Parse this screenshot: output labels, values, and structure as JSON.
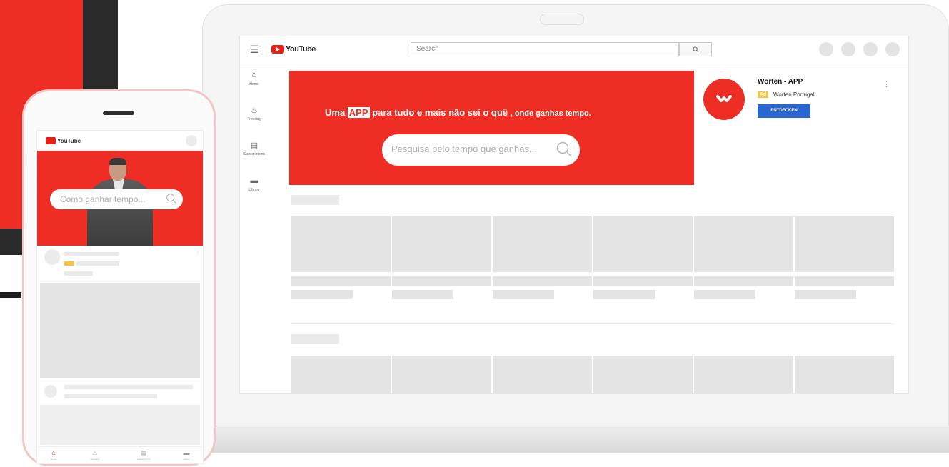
{
  "desktop": {
    "header": {
      "menu_icon": "hamburger-icon",
      "logo_text": "YouTube",
      "search_placeholder": "Search",
      "search_icon": "search-icon"
    },
    "sidebar": {
      "items": [
        {
          "label": "Home",
          "icon": "home-icon"
        },
        {
          "label": "Trending",
          "icon": "flame-icon"
        },
        {
          "label": "Subscriptions",
          "icon": "subscriptions-icon"
        },
        {
          "label": "Library",
          "icon": "folder-icon"
        }
      ]
    },
    "banner": {
      "text_before": "Uma ",
      "badge": "APP",
      "text_main": " para tudo e mais não sei o quê ",
      "text_end": ", onde ganhas tempo.",
      "search_placeholder": "Pesquisa pelo tempo que ganhas...",
      "color": "#ee2d24"
    },
    "ad": {
      "title": "Worten - APP",
      "tag": "Ad",
      "advertiser": "Worten Portugal",
      "cta": "ENTDECKEN",
      "more_icon": "more-vertical-icon",
      "cta_color": "#2866d2"
    }
  },
  "phone": {
    "logo_text": "YouTube",
    "search_placeholder": "Como ganhar tempo...",
    "nav": [
      {
        "label": "Home",
        "icon": "home-icon"
      },
      {
        "label": "Trending",
        "icon": "flame-icon"
      },
      {
        "label": "Subscriptions",
        "icon": "subscriptions-icon"
      },
      {
        "label": "Library",
        "icon": "folder-icon"
      }
    ]
  }
}
